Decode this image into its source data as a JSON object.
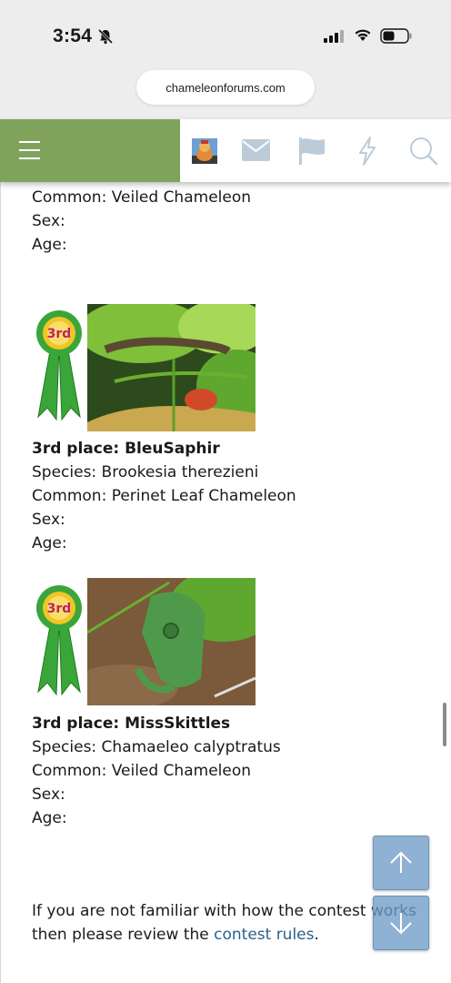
{
  "status_bar": {
    "time": "3:54"
  },
  "browser": {
    "url": "chameleonforums.com"
  },
  "entries": [
    {
      "common": "Common: Veiled Chameleon",
      "sex": "Sex:",
      "age": "Age:"
    },
    {
      "title": "3rd place: BleuSaphir",
      "species": "Species: Brookesia therezieni",
      "common": "Common: Perinet Leaf Chameleon",
      "sex": "Sex:",
      "age": "Age:",
      "ribbon_text": "3rd"
    },
    {
      "title": "3rd place: MissSkittles",
      "species": "Species: Chamaeleo calyptratus",
      "common": "Common: Veiled Chameleon",
      "sex": "Sex:",
      "age": "Age:",
      "ribbon_text": "3rd"
    }
  ],
  "footer_note": {
    "text": "If you are not familiar with how the contest works",
    "text2": "then please review the",
    "link": "contest rules",
    "end": "."
  },
  "colors": {
    "nav_green": "#7fa35b",
    "ribbon_green": "#3aa63a",
    "link": "#2b5f8a",
    "arrow_btn": "#7ba3cc"
  }
}
